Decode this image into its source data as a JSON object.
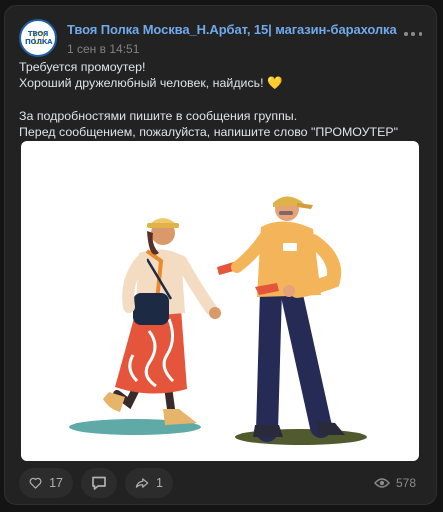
{
  "post": {
    "group_name": "Твоя Полка Москва_Н.Арбат, 15| магазин-барахолка",
    "avatar_text": "ТВОЯ ПОЛКА",
    "time": "1 сен в 14:51",
    "text_line1": "Требуется промоутер!",
    "text_line2": "Хороший дружелюбный человек, найдись! ",
    "text_heart": "💛",
    "text_line3": "За подробностями пишите в сообщения группы.",
    "text_line4": "Перед сообщением, пожалуйста, напишите слово \"ПРОМОУТЕР\""
  },
  "actions": {
    "likes": "17",
    "reposts": "1",
    "views": "578"
  },
  "icons": {
    "more": "more-horizontal-icon",
    "like": "heart-icon",
    "comment": "comment-icon",
    "share": "share-icon",
    "views": "eye-icon"
  },
  "colors": {
    "background": "#141414",
    "card": "#222222",
    "link": "#71aaeb",
    "text": "#e1e3e6",
    "muted": "#828282",
    "button": "#2c2c2c"
  }
}
